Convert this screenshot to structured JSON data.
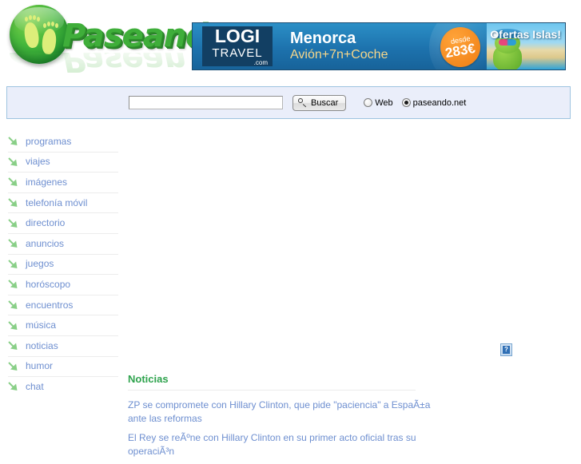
{
  "site": {
    "logo_text": "Paseando"
  },
  "banner": {
    "brand_line1": "LOGI",
    "brand_line2": "TRAVEL",
    "brand_line3": ".com",
    "title": "Menorca",
    "subtitle": "Avión+7n+Coche",
    "price_prefix": "desde",
    "price": "283€",
    "promo": "Ofertas Islas!"
  },
  "search": {
    "value": "",
    "placeholder": "",
    "button_label": "Buscar",
    "search_icon": "magnifier-icon",
    "scopes": [
      {
        "label": "Web",
        "checked": false
      },
      {
        "label": "paseando.net",
        "checked": true
      }
    ]
  },
  "sidebar": {
    "items": [
      {
        "label": "programas",
        "icon": "arrow-down-right-icon"
      },
      {
        "label": "viajes",
        "icon": "arrow-down-right-icon"
      },
      {
        "label": "imágenes",
        "icon": "arrow-down-right-icon"
      },
      {
        "label": "telefonía móvil",
        "icon": "arrow-down-right-icon"
      },
      {
        "label": "directorio",
        "icon": "arrow-down-right-icon"
      },
      {
        "label": "anuncios",
        "icon": "arrow-down-right-icon"
      },
      {
        "label": "juegos",
        "icon": "arrow-down-right-icon"
      },
      {
        "label": "horóscopo",
        "icon": "arrow-down-right-icon"
      },
      {
        "label": "encuentros",
        "icon": "arrow-down-right-icon"
      },
      {
        "label": "música",
        "icon": "arrow-down-right-icon"
      },
      {
        "label": "noticias",
        "icon": "arrow-down-right-icon"
      },
      {
        "label": "humor",
        "icon": "arrow-down-right-icon"
      },
      {
        "label": "chat",
        "icon": "arrow-down-right-icon"
      }
    ]
  },
  "main": {
    "broken_image_glyph": "?",
    "noticias": {
      "title": "Noticias",
      "headlines": [
        "ZP se compromete con Hillary Clinton, que pide \"paciencia\" a EspaÃ±a ante las reformas",
        "El Rey se reÃºne con Hillary Clinton en su primer acto oficial tras su operaciÃ³n"
      ]
    }
  },
  "colors": {
    "brand_green": "#3fae3a",
    "link_blue": "#6e8fd0",
    "heading_green": "#2fa34e",
    "panel_bg": "#eaeefa",
    "panel_border": "#9ec4e0"
  }
}
